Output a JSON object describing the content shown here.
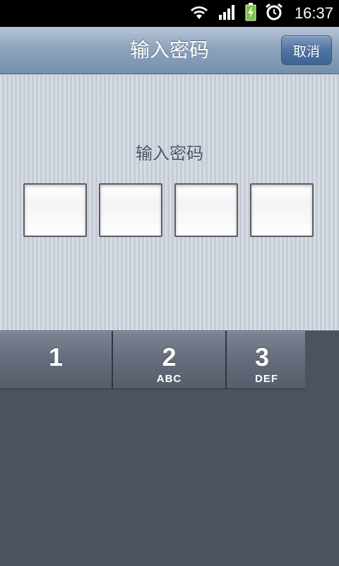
{
  "status_bar": {
    "time": "16:37",
    "icons": [
      "wifi-icon",
      "signal-icon",
      "battery-charging-icon",
      "alarm-icon"
    ]
  },
  "header": {
    "title": "输入密码",
    "cancel_label": "取消"
  },
  "main": {
    "prompt": "输入密码",
    "code_length": 4,
    "entered_digits": [
      "",
      "",
      "",
      ""
    ]
  },
  "keypad": {
    "keys": [
      {
        "number": "1",
        "letters": ""
      },
      {
        "number": "2",
        "letters": "ABC"
      },
      {
        "number": "3",
        "letters": "DEF"
      }
    ]
  },
  "colors": {
    "nav_bar": "#8ea3bd",
    "cancel_button": "#4f74a3",
    "content_bg": "#c9d0da",
    "keypad_bg": "#4b5260",
    "key_bg": "#646c7b"
  }
}
